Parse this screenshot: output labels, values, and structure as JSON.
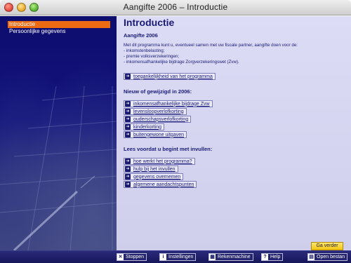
{
  "window": {
    "title": "Aangifte 2006 – Introductie"
  },
  "sidebar": {
    "items": [
      {
        "label": "Introductie",
        "active": true
      },
      {
        "label": "Persoonlijke gegevens",
        "active": false
      }
    ]
  },
  "main": {
    "title": "Introductie",
    "subtitle": "Aangifte 2006",
    "intro_lines": [
      "Met dit programma kunt u, eventueel samen met uw fiscale partner, aangifte doen voor de:",
      "- inkomstenbelasting;",
      "- premie volksverzekeringen;",
      "- inkomensafhankelijke bijdrage Zorgverzekeringswet (Zvw)."
    ],
    "accessibility_link": "toegankelijkheid van het programma",
    "new_section": {
      "title": "Nieuw of gewijzigd in 2006:",
      "links": [
        "inkomensafhankelijke bijdrage Zvw",
        "levensloopverlofkorting",
        "ouderschapsverlofkorting",
        "kinderkorting",
        "buitengewone uitgaven"
      ]
    },
    "read_section": {
      "title": "Lees voordat u begint met invullen:",
      "links": [
        "hoe werkt het programma?",
        "hulp bij het invullen",
        "gegevens overnemen",
        "algemene aandachtspunten"
      ]
    },
    "next_label": "Ga verder"
  },
  "toolbar": {
    "buttons": [
      {
        "label": "Stoppen",
        "icon": "x-icon"
      },
      {
        "label": "Instellingen",
        "icon": "info-icon"
      },
      {
        "label": "Rekenmachine",
        "icon": "calculator-icon"
      },
      {
        "label": "Help",
        "icon": "help-icon"
      },
      {
        "label": "Open bestan",
        "icon": "folder-icon"
      }
    ]
  },
  "colors": {
    "accent": "#ec6a12",
    "primary_text": "#1a1a78",
    "next_button": "#f3c412"
  }
}
